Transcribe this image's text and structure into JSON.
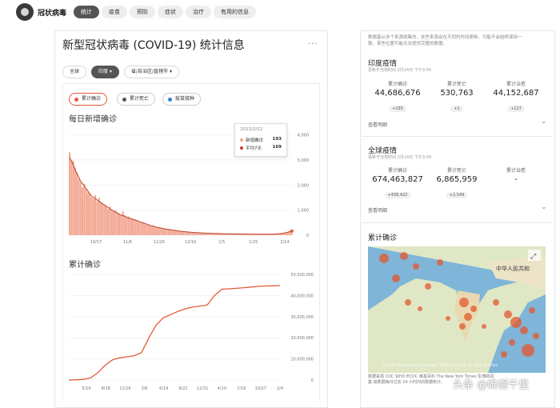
{
  "topbar": {
    "brand": "冠状病毒",
    "tabs": [
      "统计",
      "疫苗",
      "预防",
      "症状",
      "治疗",
      "有用的信息"
    ]
  },
  "main": {
    "title": "新型冠状病毒 (COVID-19) 统计信息",
    "more": "···",
    "filters": [
      "全球",
      "印度 ▾",
      "省/自治区/直辖市 ▾"
    ],
    "segments": [
      "累计确诊",
      "累计死亡",
      "疫苗接种"
    ],
    "colors": {
      "accent": "#e25c38",
      "bar": "#f2a58f",
      "line": "#b9432b",
      "vaccine": "#2f7fd8"
    }
  },
  "tooltip": {
    "date": "2023/2/22",
    "rows": [
      {
        "label": "新增确诊",
        "value": "193"
      },
      {
        "label": "平均7天",
        "value": "169"
      }
    ]
  },
  "chart_data": [
    {
      "type": "bar",
      "title": "每日新增确诊",
      "x_ticks": [
        "10/17",
        "11/6",
        "11/26",
        "12/16",
        "1/5",
        "1/25",
        "2/14"
      ],
      "y_ticks": [
        "0",
        "1,000",
        "2,000",
        "3,000",
        "4,000"
      ],
      "ylim": [
        0,
        4400
      ],
      "values": [
        3300,
        3000,
        2950,
        2700,
        2500,
        2250,
        2100,
        1900,
        2050,
        1850,
        1700,
        1650,
        1500,
        1450,
        1600,
        1350,
        1500,
        1300,
        1250,
        1200,
        1150,
        1050,
        1150,
        1000,
        950,
        1000,
        900,
        850,
        800,
        950,
        800,
        700,
        750,
        700,
        650,
        650,
        600,
        580,
        520,
        500,
        520,
        480,
        420,
        400,
        380,
        360,
        340,
        330,
        300,
        290,
        280,
        260,
        250,
        240,
        230,
        220,
        200,
        190,
        180,
        170,
        160,
        150,
        150,
        140,
        130,
        120,
        120,
        110,
        110,
        100,
        100,
        95,
        90,
        90,
        85,
        80,
        80,
        75,
        75,
        70,
        70,
        65,
        65,
        60,
        60,
        60,
        55,
        55,
        55,
        50,
        50,
        50,
        50,
        48,
        48,
        46,
        46,
        45,
        45,
        44,
        44,
        43,
        43,
        42,
        42,
        41,
        41,
        40,
        40,
        40,
        40,
        42,
        45,
        50,
        55,
        60,
        70,
        80,
        100,
        130,
        160,
        193
      ],
      "avg7": [
        3100,
        2950,
        2800,
        2600,
        2450,
        2300,
        2150,
        2050,
        1950,
        1850,
        1750,
        1650,
        1550,
        1500,
        1450,
        1400,
        1350,
        1300,
        1250,
        1200,
        1150,
        1100,
        1050,
        1000,
        960,
        920,
        880,
        840,
        800,
        780,
        750,
        720,
        690,
        660,
        640,
        620,
        600,
        570,
        540,
        510,
        490,
        470,
        440,
        410,
        390,
        370,
        350,
        330,
        310,
        295,
        280,
        265,
        252,
        240,
        228,
        216,
        205,
        193,
        182,
        172,
        163,
        155,
        148,
        140,
        132,
        125,
        119,
        113,
        108,
        103,
        99,
        95,
        91,
        88,
        84,
        81,
        78,
        75,
        73,
        70,
        68,
        66,
        64,
        62,
        60,
        58,
        57,
        55,
        54,
        52,
        51,
        50,
        49,
        48,
        47,
        46,
        45,
        45,
        44,
        44,
        43,
        43,
        42,
        42,
        41,
        41,
        41,
        40,
        40,
        41,
        42,
        44,
        48,
        53,
        59,
        66,
        75,
        88,
        105,
        125,
        147,
        169
      ]
    },
    {
      "type": "line",
      "title": "累计确诊",
      "x_ticks": [
        "5/10",
        "8/18",
        "11/26",
        "3/6",
        "6/14",
        "9/22",
        "12/31",
        "4/10",
        "7/19",
        "10/27",
        "2/4"
      ],
      "y_ticks": [
        "0",
        "10,000,000",
        "20,000,000",
        "30,000,000",
        "40,000,000",
        "50,000,000"
      ],
      "ylim": [
        0,
        50000000
      ],
      "values": [
        0,
        100000,
        300000,
        1000000,
        3500000,
        7000000,
        9500000,
        10500000,
        11000000,
        11500000,
        13000000,
        20000000,
        26000000,
        29500000,
        31000000,
        32500000,
        33700000,
        34500000,
        35000000,
        35500000,
        40000000,
        43000000,
        43200000,
        43400000,
        43700000,
        44000000,
        44300000,
        44500000,
        44600000,
        44686676
      ]
    }
  ],
  "right": {
    "note_l1": "数据基从多个来源收集的，这些来源会在不同的时间更新，可能不会始终保持一",
    "note_l2": "致。某些位置可能无法提供完整的数据。",
    "india": {
      "title": "印度疫情",
      "sub": "更新于当地时间 2月24日 下午3:09",
      "stats": [
        {
          "label": "累计确诊",
          "value": "44,686,676",
          "delta": "+193"
        },
        {
          "label": "累计死亡",
          "value": "530,763",
          "delta": "+1"
        },
        {
          "label": "累计治愈",
          "value": "44,152,687",
          "delta": "+127"
        }
      ],
      "detail": "查看明细"
    },
    "global": {
      "title": "全球疫情",
      "sub": "更新于当地时间 2月24日 下午3:09",
      "stats": [
        {
          "label": "累计确诊",
          "value": "674,463,827",
          "delta": "+436,422"
        },
        {
          "label": "累计死亡",
          "value": "6,865,959",
          "delta": "+2,549"
        },
        {
          "label": "累计治愈",
          "value": "-",
          "delta": ""
        }
      ],
      "detail": "查看明细"
    },
    "map_title": "累计确诊",
    "map_labels": {
      "china": "中华人民共和",
      "copyright": "© 2023 Microsoft Corporation - GS(2021)1731, © 2022 TomTom"
    },
    "map_foot_l1": "数据来源 CDC  WHO  ECDC  维基百科  The New York Times  彭博新闻",
    "map_foot_l2": "集  级数据每日过去 24 小时内的数据统计。",
    "watermark": "头条 @帷幄千里"
  }
}
